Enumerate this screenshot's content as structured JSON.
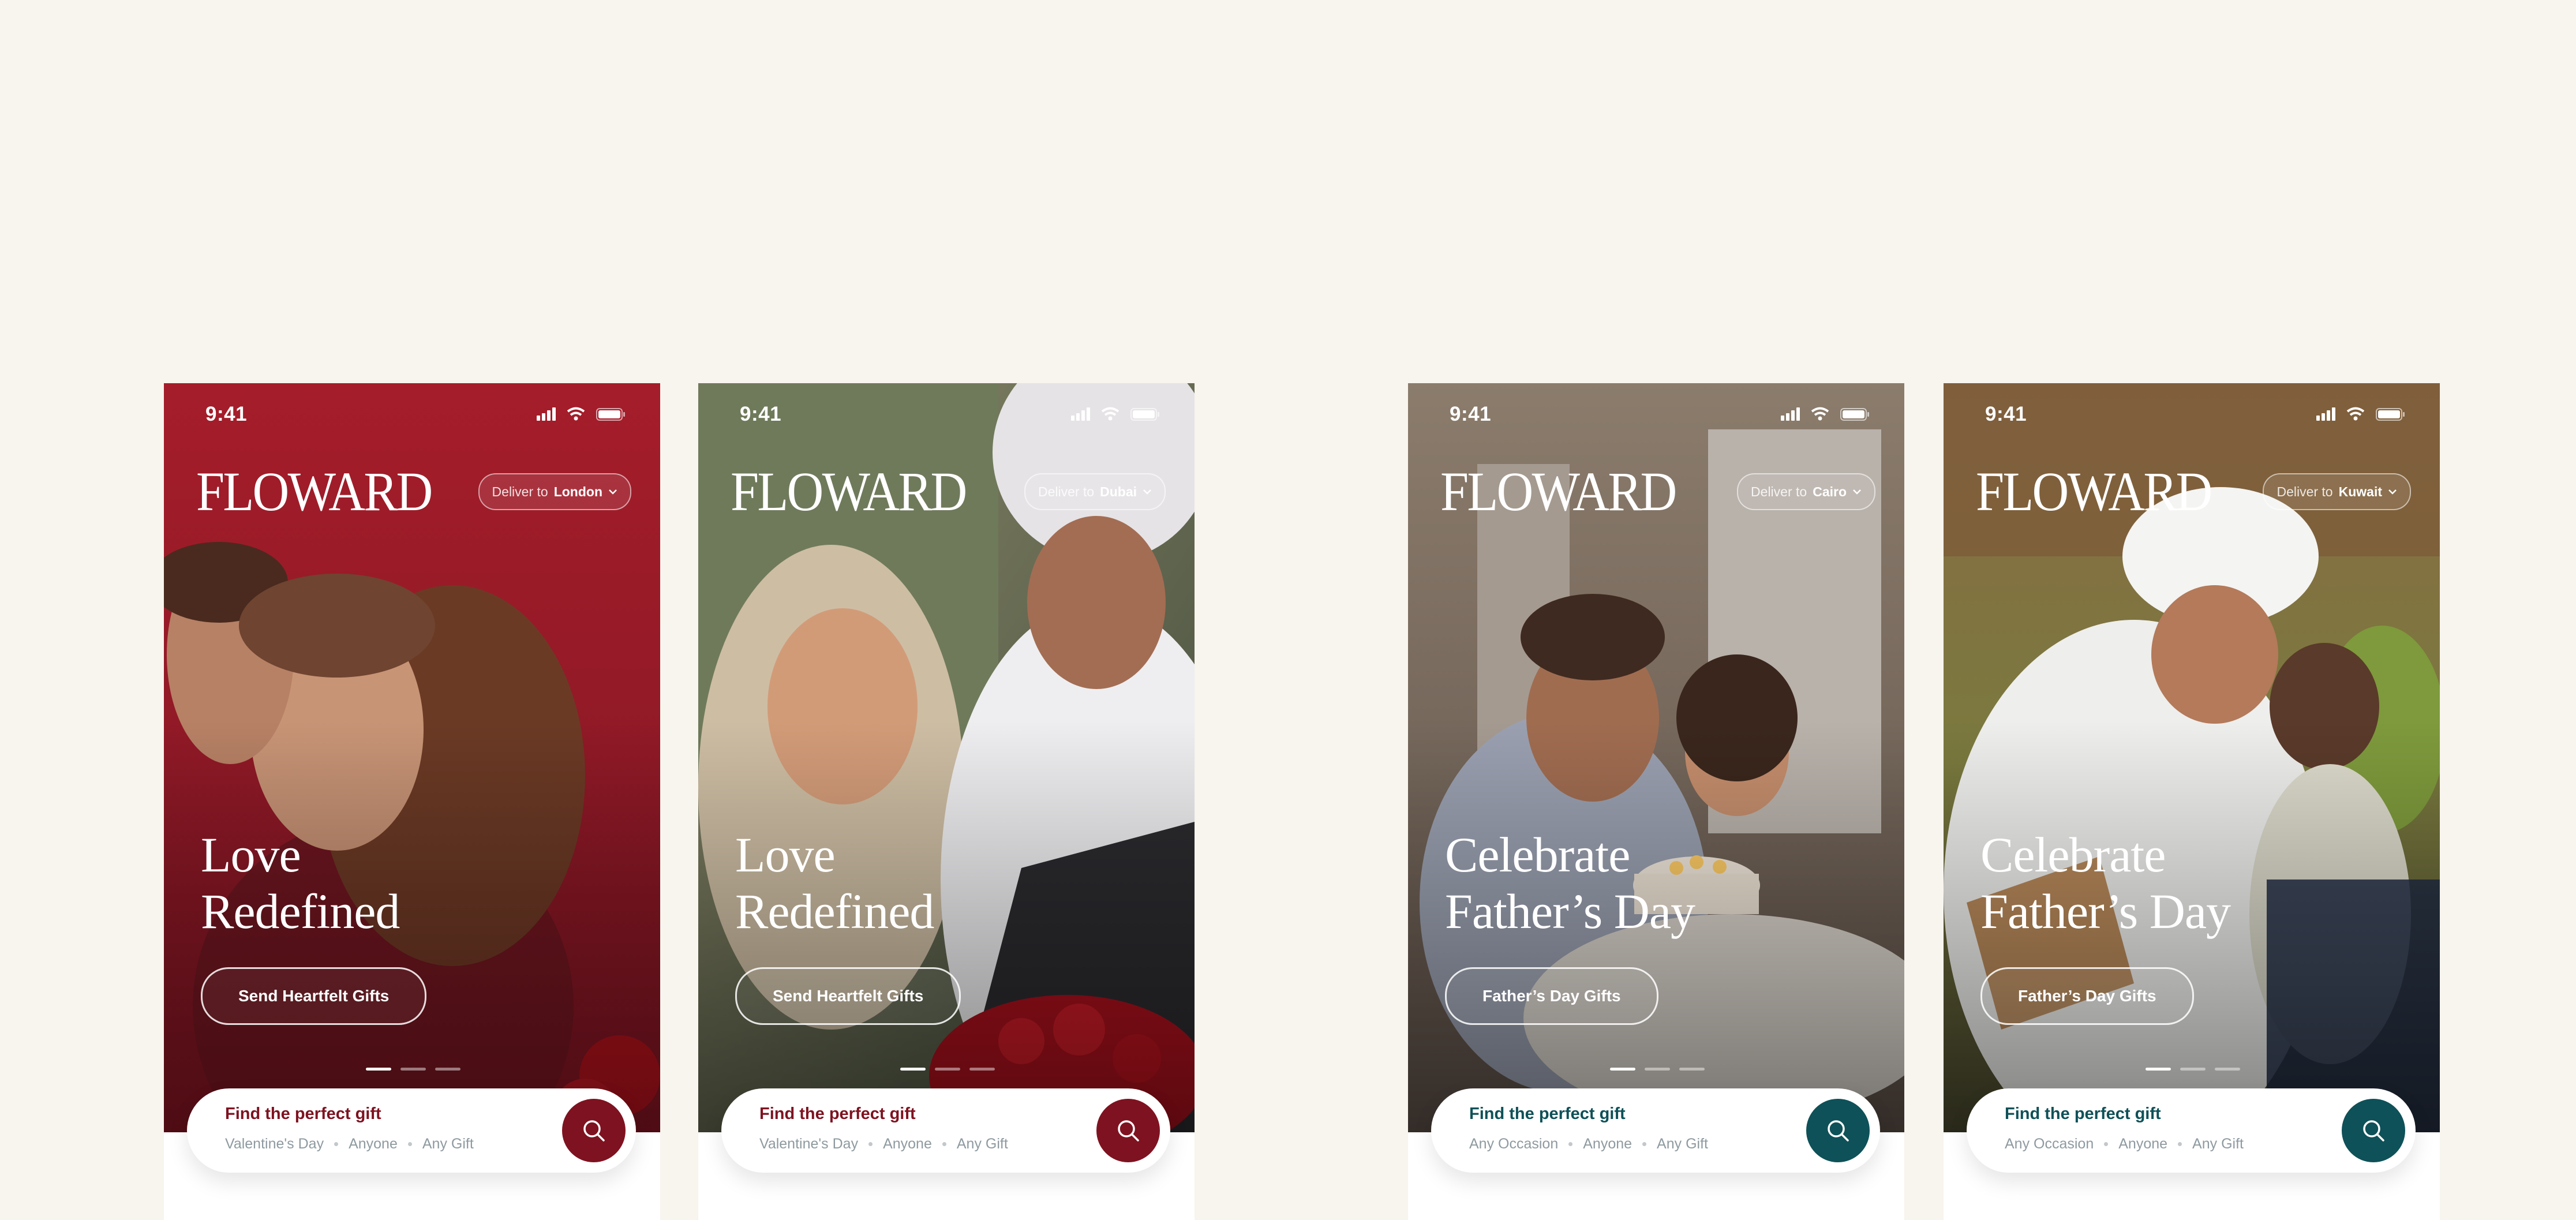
{
  "theme": {
    "valentine_accent": "#7f1220",
    "fathers_accent": "#0e5158",
    "background": "#f8f4ee"
  },
  "screens": [
    {
      "time": "9:41",
      "brand": "FLOWARD",
      "deliver_label": "Deliver to",
      "city": "London",
      "headline_line1": "Love",
      "headline_line2": "Redefined",
      "cta": "Send Heartfelt Gifts",
      "search_title": "Find the perfect gift",
      "chip1": "Valentine's Day",
      "chip2": "Anyone",
      "chip3": "Any Gift",
      "carousel_active_index": 1
    },
    {
      "time": "9:41",
      "brand": "FLOWARD",
      "deliver_label": "Deliver to",
      "city": "Dubai",
      "headline_line1": "Love",
      "headline_line2": "Redefined",
      "cta": "Send Heartfelt Gifts",
      "search_title": "Find the perfect gift",
      "chip1": "Valentine's Day",
      "chip2": "Anyone",
      "chip3": "Any Gift",
      "carousel_active_index": 1
    },
    {
      "time": "9:41",
      "brand": "FLOWARD",
      "deliver_label": "Deliver to",
      "city": "Cairo",
      "headline_line1": "Celebrate",
      "headline_line2": "Father’s Day",
      "cta": "Father’s Day Gifts",
      "search_title": "Find the perfect gift",
      "chip1": "Any Occasion",
      "chip2": "Anyone",
      "chip3": "Any Gift",
      "carousel_active_index": 1
    },
    {
      "time": "9:41",
      "brand": "FLOWARD",
      "deliver_label": "Deliver to",
      "city": "Kuwait",
      "headline_line1": "Celebrate",
      "headline_line2": "Father’s Day",
      "cta": "Father’s Day Gifts",
      "search_title": "Find the perfect gift",
      "chip1": "Any Occasion",
      "chip2": "Anyone",
      "chip3": "Any Gift",
      "carousel_active_index": 1
    }
  ]
}
